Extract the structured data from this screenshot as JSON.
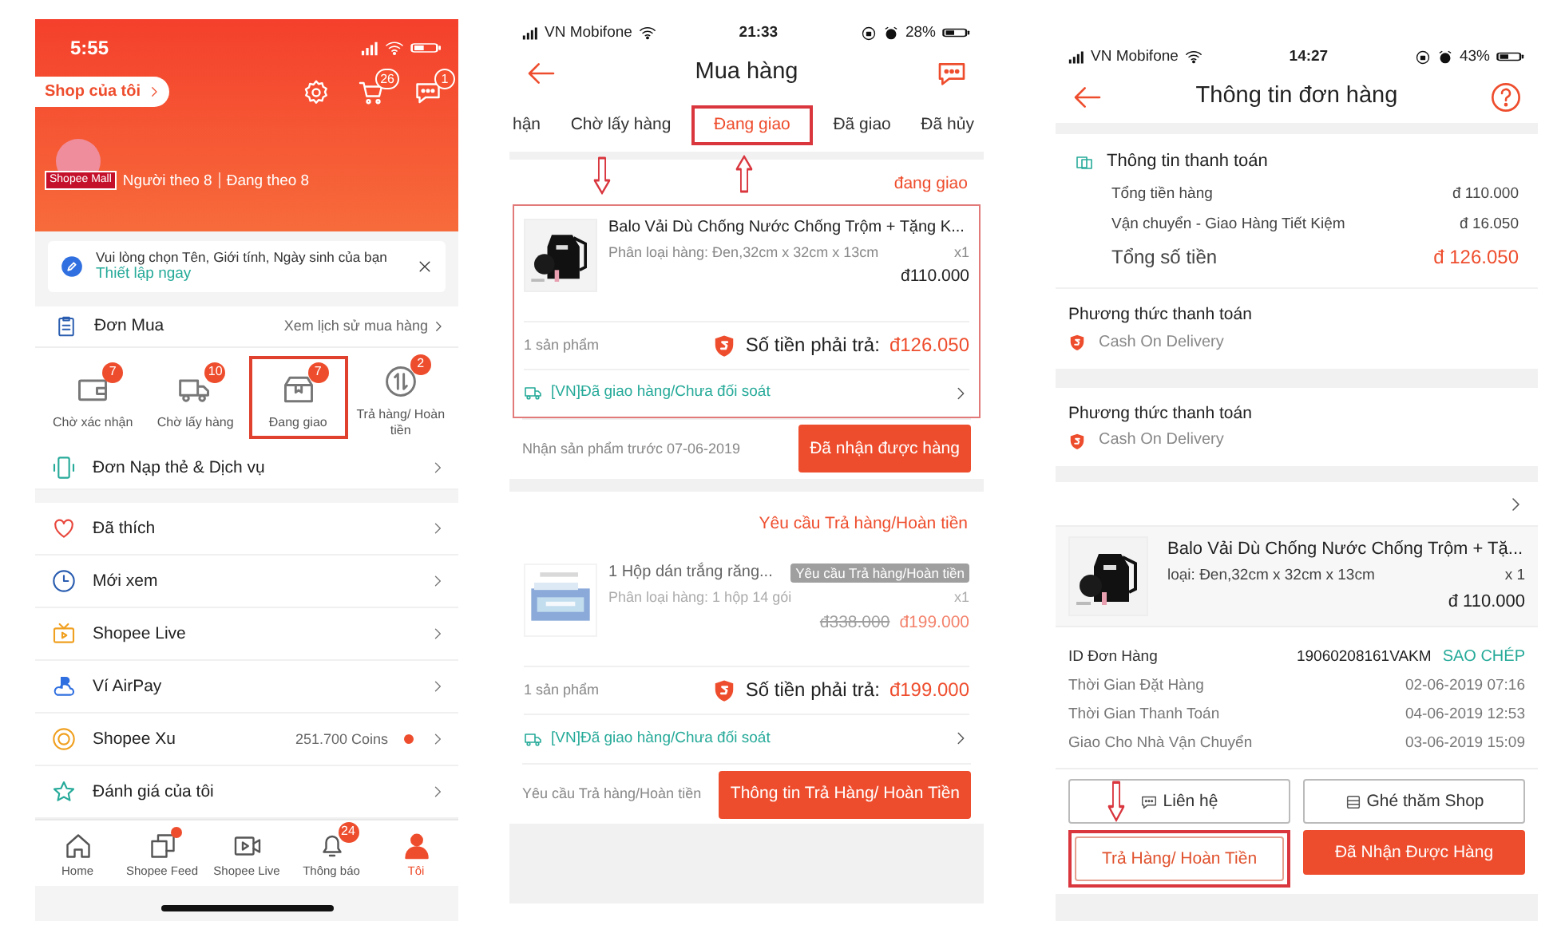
{
  "account_screen": {
    "status_bar": {
      "time": "5:55"
    },
    "shop_link": "Shop của tôi",
    "header_icons": [
      {
        "kind": "settings"
      },
      {
        "kind": "cart",
        "badge": "26"
      },
      {
        "kind": "chat",
        "badge": "1"
      }
    ],
    "profile": {
      "mall_tag": "Shopee Mall",
      "followers": "Người theo 8",
      "following": "Đang theo 8"
    },
    "notice": {
      "text": "Vui lòng chọn Tên, Giới tính, Ngày sinh của bạn",
      "link": "Thiết lập ngay"
    },
    "purchases": {
      "title": "Đơn Mua",
      "history_link": "Xem lịch sử mua hàng",
      "statuses": [
        {
          "kind": "wallet",
          "label": "Chờ xác nhận",
          "badge": "7",
          "highlighted": false
        },
        {
          "kind": "truck",
          "label": "Chờ lấy hàng",
          "badge": "10",
          "highlighted": false
        },
        {
          "kind": "box",
          "label": "Đang giao",
          "badge": "7",
          "highlighted": true
        },
        {
          "kind": "return",
          "label": "Trả hàng/ Hoàn tiền",
          "badge": "2",
          "highlighted": false
        }
      ]
    },
    "menu_groups": [
      {
        "items": [
          {
            "kind": "phone",
            "label": "Đơn Nạp thẻ & Dịch vụ",
            "dot": false
          }
        ]
      },
      {
        "items": [
          {
            "kind": "heart",
            "label": "Đã thích",
            "dot": false
          },
          {
            "kind": "clock",
            "label": "Mới xem",
            "dot": false
          },
          {
            "kind": "tv",
            "label": "Shopee Live",
            "dot": false
          },
          {
            "kind": "cloud",
            "label": "Ví AirPay",
            "dot": false
          },
          {
            "kind": "coin",
            "label": "Shopee Xu",
            "value": "251.700 Coins",
            "dot": true
          },
          {
            "kind": "star",
            "label": "Đánh giá của tôi",
            "dot": false
          }
        ]
      }
    ],
    "bottom_nav": [
      {
        "kind": "home",
        "label": "Home",
        "selected": false,
        "dot": false
      },
      {
        "kind": "pages",
        "label": "Shopee Feed",
        "selected": false,
        "dot": true
      },
      {
        "kind": "video",
        "label": "Shopee Live",
        "selected": false,
        "dot": false
      },
      {
        "kind": "bell",
        "label": "Thông báo",
        "badge": "24",
        "selected": false,
        "dot": false
      },
      {
        "kind": "person",
        "label": "Tôi",
        "selected": true,
        "dot": false
      }
    ]
  },
  "purchase_screen": {
    "status_bar": {
      "carrier": "VN Mobifone",
      "time": "21:33",
      "battery": "28%"
    },
    "title": "Mua hàng",
    "tabs": [
      {
        "label": "hận",
        "selected": false,
        "highlighted": false
      },
      {
        "label": "Chờ lấy hàng",
        "selected": false,
        "highlighted": false
      },
      {
        "label": "Đang giao",
        "selected": true,
        "highlighted": true
      },
      {
        "label": "Đã giao",
        "selected": false,
        "highlighted": false
      },
      {
        "label": "Đã hủy",
        "selected": false,
        "highlighted": false
      }
    ],
    "orders": [
      {
        "status": "đang giao",
        "highlighted": true,
        "dimmed": false,
        "product": {
          "name": "Balo Vải Dù Chống Nước Chống Trộm + Tặng K...",
          "variant": "Phân loại hàng: Đen,32cm x 32cm x 13cm",
          "quantity": "x1",
          "price": "đ110.000"
        },
        "count": "1 sản phẩm",
        "total_label": "Số tiền phải trả:",
        "total": "đ126.050",
        "shipping": "[VN]Đã giao hàng/Chưa đối soát",
        "note": "Nhận sản phẩm trước 07-06-2019",
        "action": "Đã nhận được hàng"
      },
      {
        "status": "Yêu cầu Trả hàng/Hoàn tiền",
        "highlighted": false,
        "dimmed": true,
        "product": {
          "name": "1 Hộp dán trắng răng...",
          "tag": "Yêu cầu Trả hàng/Hoàn tiền",
          "variant": "Phân loại hàng: 1 hộp 14 gói",
          "quantity": "x1",
          "old_price": "đ338.000",
          "price": "đ199.000"
        },
        "count": "1 sản phẩm",
        "total_label": "Số tiền phải trả:",
        "total": "đ199.000",
        "shipping": "[VN]Đã giao hàng/Chưa đối soát",
        "note": "Yêu cầu Trả hàng/Hoàn tiền",
        "action": "Thông tin Trả Hàng/ Hoàn Tiền"
      }
    ]
  },
  "order_detail_screen": {
    "status_bar": {
      "carrier": "VN Mobifone",
      "time": "14:27",
      "battery": "43%"
    },
    "title": "Thông tin đơn hàng",
    "payment_info": {
      "title": "Thông tin thanh toán",
      "rows": [
        {
          "kind": "line",
          "label": "Tổng tiền hàng",
          "value": "đ 110.000"
        },
        {
          "kind": "line",
          "label": "Vận chuyển - Giao Hàng Tiết Kiệm",
          "value": "đ 16.050"
        },
        {
          "kind": "total",
          "label": "Tổng số tiền",
          "value": "đ 126.050"
        }
      ]
    },
    "payment_methods": [
      {
        "title": "Phương thức thanh toán",
        "method": "Cash On Delivery"
      },
      {
        "title": "Phương thức thanh toán",
        "method": "Cash On Delivery"
      }
    ],
    "product": {
      "name": "Balo Vải Dù Chống Nước Chống Trộm + Tặ...",
      "variant": "loại: Đen,32cm x 32cm x 13cm",
      "quantity": "x 1",
      "price": "đ 110.000"
    },
    "details": [
      {
        "label": "ID Đơn Hàng",
        "value": "19060208161VAKM",
        "action": "SAO CHÉP"
      },
      {
        "label": "Thời Gian Đặt Hàng",
        "value": "02-06-2019 07:16"
      },
      {
        "label": "Thời Gian Thanh Toán",
        "value": "04-06-2019 12:53"
      },
      {
        "label": "Giao Cho Nhà Vận Chuyển",
        "value": "03-06-2019 15:09"
      }
    ],
    "buttons": [
      {
        "kind": "outline",
        "label": "Liên hệ",
        "highlighted": false
      },
      {
        "kind": "outline",
        "label": "Ghé thăm Shop",
        "highlighted": false
      },
      {
        "kind": "outline_accent",
        "label": "Trả Hàng/ Hoàn Tiền",
        "highlighted": true
      },
      {
        "kind": "solid",
        "label": "Đã Nhận Được Hàng",
        "highlighted": false
      }
    ]
  }
}
